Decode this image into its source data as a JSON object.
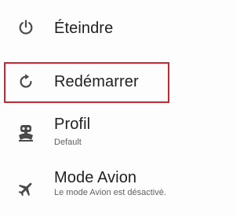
{
  "menu": {
    "items": [
      {
        "icon": "power-icon",
        "label": "Éteindre"
      },
      {
        "icon": "restart-icon",
        "label": "Redémarrer"
      },
      {
        "icon": "profile-icon",
        "label": "Profil",
        "sublabel": "Default"
      },
      {
        "icon": "airplane-icon",
        "label": "Mode Avion",
        "sublabel": "Le mode Avion est désactivé."
      }
    ],
    "highlight_color": "#d6222c"
  }
}
